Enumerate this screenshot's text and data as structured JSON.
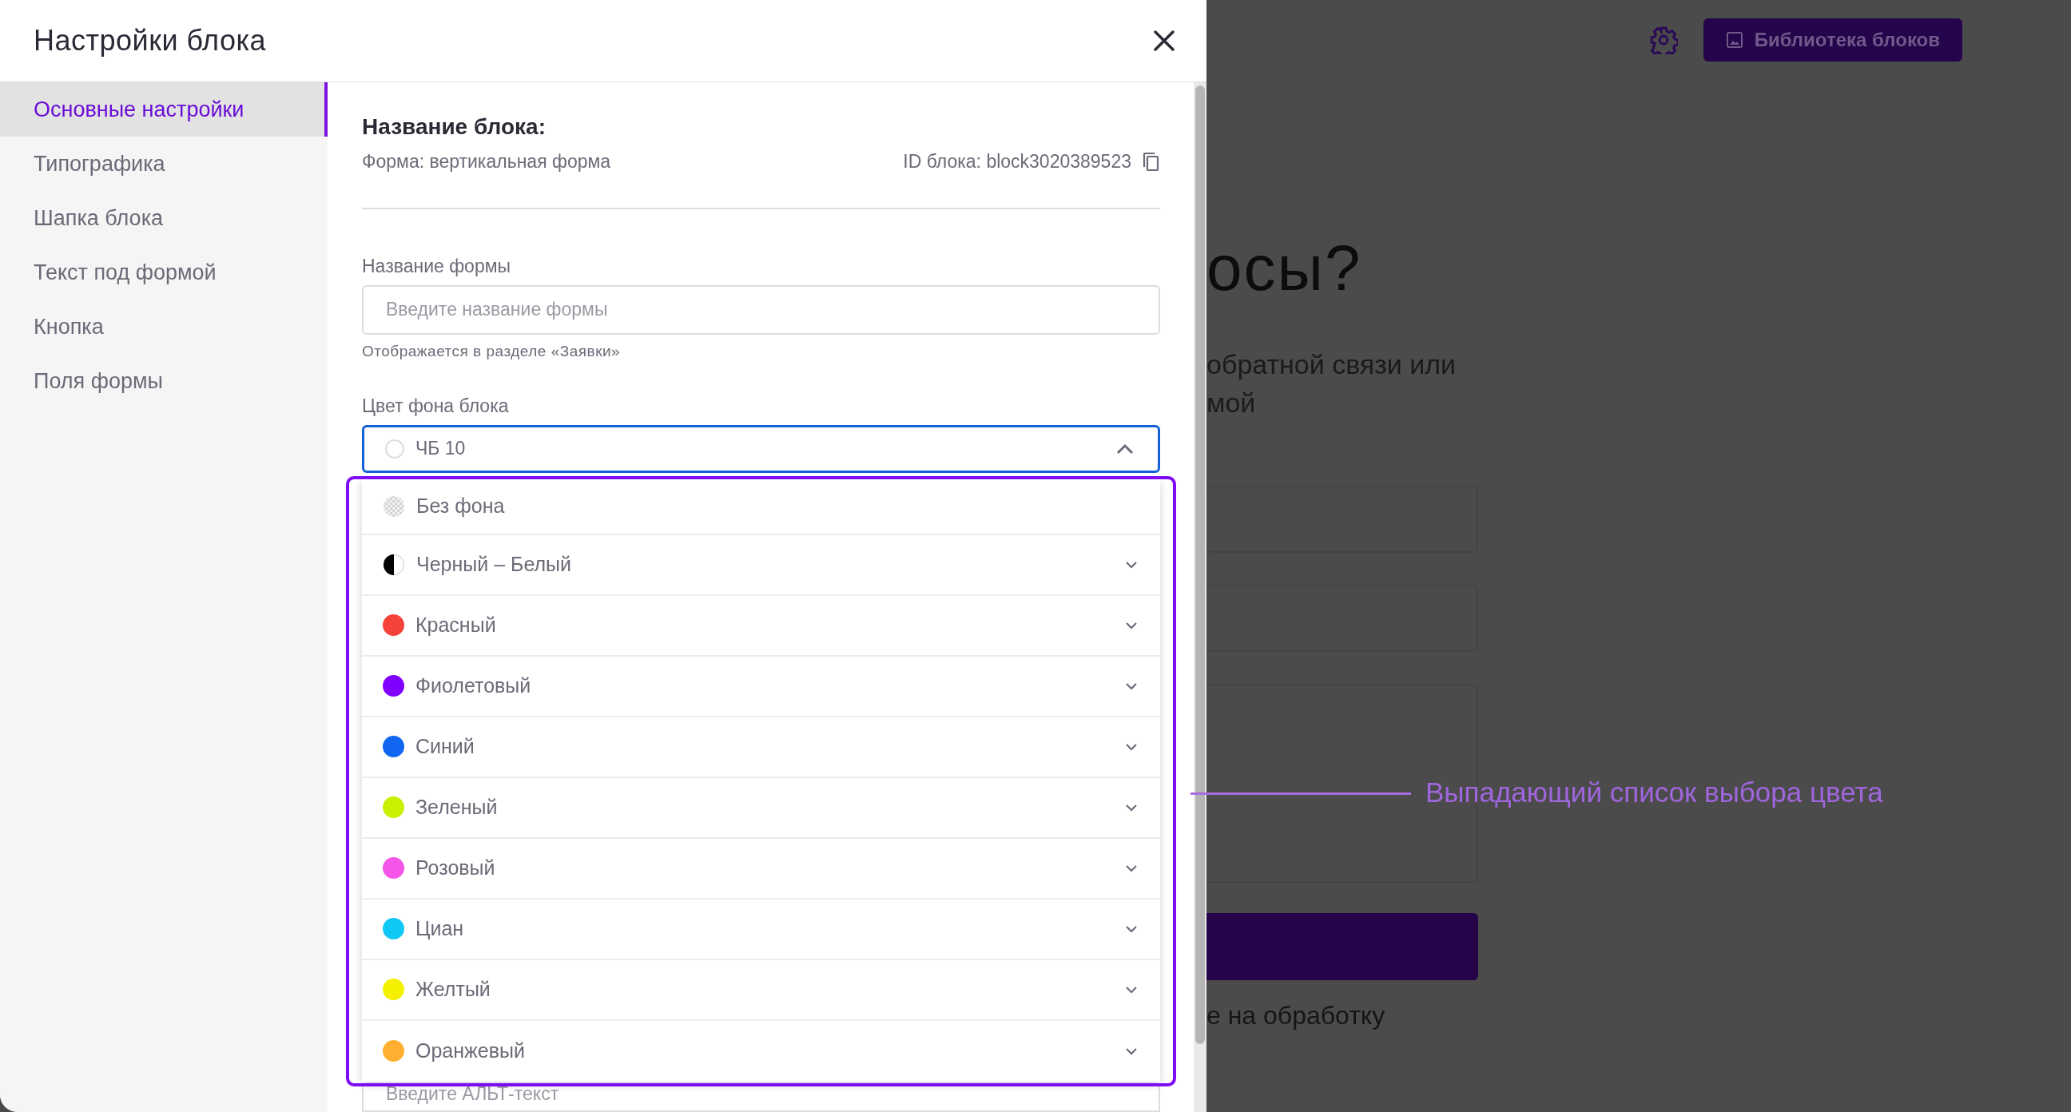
{
  "modal": {
    "title": "Настройки блока"
  },
  "sidebar": {
    "items": [
      {
        "label": "Основные настройки",
        "selected": true
      },
      {
        "label": "Типографика",
        "selected": false
      },
      {
        "label": "Шапка блока",
        "selected": false
      },
      {
        "label": "Текст под формой",
        "selected": false
      },
      {
        "label": "Кнопка",
        "selected": false
      },
      {
        "label": "Поля формы",
        "selected": false
      }
    ]
  },
  "block": {
    "heading": "Название блока:",
    "form_type": "Форма: вертикальная форма",
    "id": "ID блока: block3020389523"
  },
  "form_name": {
    "label": "Название формы",
    "placeholder": "Введите название формы",
    "hint": "Отображается в разделе «Заявки»"
  },
  "bg_color": {
    "label": "Цвет фона блока",
    "value": "ЧБ 10",
    "expanded": true,
    "options": [
      {
        "label": "Без фона",
        "kind": "none",
        "expandable": false
      },
      {
        "label": "Черный – Белый",
        "kind": "split",
        "expandable": true
      },
      {
        "label": "Красный",
        "kind": "solid",
        "color": "#f5433a",
        "expandable": true
      },
      {
        "label": "Фиолетовый",
        "kind": "solid",
        "color": "#8000ff",
        "expandable": true
      },
      {
        "label": "Синий",
        "kind": "solid",
        "color": "#1066f0",
        "expandable": true
      },
      {
        "label": "Зеленый",
        "kind": "solid",
        "color": "#c8f000",
        "expandable": true
      },
      {
        "label": "Розовый",
        "kind": "solid",
        "color": "#f555e8",
        "expandable": true
      },
      {
        "label": "Циан",
        "kind": "solid",
        "color": "#10c8f5",
        "expandable": true
      },
      {
        "label": "Желтый",
        "kind": "solid",
        "color": "#f5f000",
        "expandable": true
      },
      {
        "label": "Оранжевый",
        "kind": "solid",
        "color": "#ffb030",
        "expandable": true
      }
    ]
  },
  "alt_text": {
    "placeholder": "Введите АЛЬТ-текст"
  },
  "background_page": {
    "library_button": "Библиотека блоков",
    "heading": "осы?",
    "text_lines": [
      "обратной связи или",
      "мой"
    ],
    "consent": "е на обработку"
  },
  "annotation": {
    "label": "Выпадающий список выбора цвета"
  }
}
